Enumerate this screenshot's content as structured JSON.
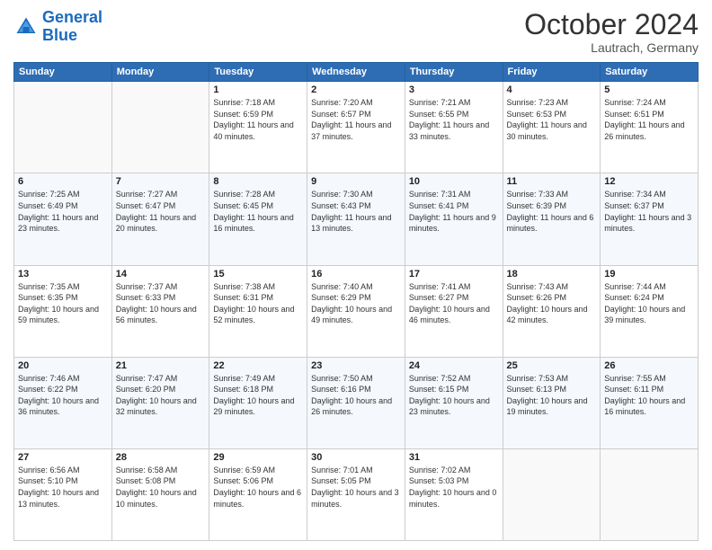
{
  "header": {
    "logo_line1": "General",
    "logo_line2": "Blue",
    "month": "October 2024",
    "location": "Lautrach, Germany"
  },
  "days_of_week": [
    "Sunday",
    "Monday",
    "Tuesday",
    "Wednesday",
    "Thursday",
    "Friday",
    "Saturday"
  ],
  "weeks": [
    [
      {
        "num": "",
        "info": ""
      },
      {
        "num": "",
        "info": ""
      },
      {
        "num": "1",
        "info": "Sunrise: 7:18 AM\nSunset: 6:59 PM\nDaylight: 11 hours and 40 minutes."
      },
      {
        "num": "2",
        "info": "Sunrise: 7:20 AM\nSunset: 6:57 PM\nDaylight: 11 hours and 37 minutes."
      },
      {
        "num": "3",
        "info": "Sunrise: 7:21 AM\nSunset: 6:55 PM\nDaylight: 11 hours and 33 minutes."
      },
      {
        "num": "4",
        "info": "Sunrise: 7:23 AM\nSunset: 6:53 PM\nDaylight: 11 hours and 30 minutes."
      },
      {
        "num": "5",
        "info": "Sunrise: 7:24 AM\nSunset: 6:51 PM\nDaylight: 11 hours and 26 minutes."
      }
    ],
    [
      {
        "num": "6",
        "info": "Sunrise: 7:25 AM\nSunset: 6:49 PM\nDaylight: 11 hours and 23 minutes."
      },
      {
        "num": "7",
        "info": "Sunrise: 7:27 AM\nSunset: 6:47 PM\nDaylight: 11 hours and 20 minutes."
      },
      {
        "num": "8",
        "info": "Sunrise: 7:28 AM\nSunset: 6:45 PM\nDaylight: 11 hours and 16 minutes."
      },
      {
        "num": "9",
        "info": "Sunrise: 7:30 AM\nSunset: 6:43 PM\nDaylight: 11 hours and 13 minutes."
      },
      {
        "num": "10",
        "info": "Sunrise: 7:31 AM\nSunset: 6:41 PM\nDaylight: 11 hours and 9 minutes."
      },
      {
        "num": "11",
        "info": "Sunrise: 7:33 AM\nSunset: 6:39 PM\nDaylight: 11 hours and 6 minutes."
      },
      {
        "num": "12",
        "info": "Sunrise: 7:34 AM\nSunset: 6:37 PM\nDaylight: 11 hours and 3 minutes."
      }
    ],
    [
      {
        "num": "13",
        "info": "Sunrise: 7:35 AM\nSunset: 6:35 PM\nDaylight: 10 hours and 59 minutes."
      },
      {
        "num": "14",
        "info": "Sunrise: 7:37 AM\nSunset: 6:33 PM\nDaylight: 10 hours and 56 minutes."
      },
      {
        "num": "15",
        "info": "Sunrise: 7:38 AM\nSunset: 6:31 PM\nDaylight: 10 hours and 52 minutes."
      },
      {
        "num": "16",
        "info": "Sunrise: 7:40 AM\nSunset: 6:29 PM\nDaylight: 10 hours and 49 minutes."
      },
      {
        "num": "17",
        "info": "Sunrise: 7:41 AM\nSunset: 6:27 PM\nDaylight: 10 hours and 46 minutes."
      },
      {
        "num": "18",
        "info": "Sunrise: 7:43 AM\nSunset: 6:26 PM\nDaylight: 10 hours and 42 minutes."
      },
      {
        "num": "19",
        "info": "Sunrise: 7:44 AM\nSunset: 6:24 PM\nDaylight: 10 hours and 39 minutes."
      }
    ],
    [
      {
        "num": "20",
        "info": "Sunrise: 7:46 AM\nSunset: 6:22 PM\nDaylight: 10 hours and 36 minutes."
      },
      {
        "num": "21",
        "info": "Sunrise: 7:47 AM\nSunset: 6:20 PM\nDaylight: 10 hours and 32 minutes."
      },
      {
        "num": "22",
        "info": "Sunrise: 7:49 AM\nSunset: 6:18 PM\nDaylight: 10 hours and 29 minutes."
      },
      {
        "num": "23",
        "info": "Sunrise: 7:50 AM\nSunset: 6:16 PM\nDaylight: 10 hours and 26 minutes."
      },
      {
        "num": "24",
        "info": "Sunrise: 7:52 AM\nSunset: 6:15 PM\nDaylight: 10 hours and 23 minutes."
      },
      {
        "num": "25",
        "info": "Sunrise: 7:53 AM\nSunset: 6:13 PM\nDaylight: 10 hours and 19 minutes."
      },
      {
        "num": "26",
        "info": "Sunrise: 7:55 AM\nSunset: 6:11 PM\nDaylight: 10 hours and 16 minutes."
      }
    ],
    [
      {
        "num": "27",
        "info": "Sunrise: 6:56 AM\nSunset: 5:10 PM\nDaylight: 10 hours and 13 minutes."
      },
      {
        "num": "28",
        "info": "Sunrise: 6:58 AM\nSunset: 5:08 PM\nDaylight: 10 hours and 10 minutes."
      },
      {
        "num": "29",
        "info": "Sunrise: 6:59 AM\nSunset: 5:06 PM\nDaylight: 10 hours and 6 minutes."
      },
      {
        "num": "30",
        "info": "Sunrise: 7:01 AM\nSunset: 5:05 PM\nDaylight: 10 hours and 3 minutes."
      },
      {
        "num": "31",
        "info": "Sunrise: 7:02 AM\nSunset: 5:03 PM\nDaylight: 10 hours and 0 minutes."
      },
      {
        "num": "",
        "info": ""
      },
      {
        "num": "",
        "info": ""
      }
    ]
  ]
}
